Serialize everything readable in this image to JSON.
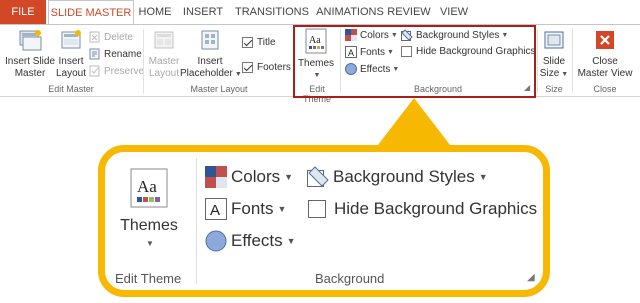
{
  "tabs": [
    "FILE",
    "SLIDE MASTER",
    "HOME",
    "INSERT",
    "TRANSITIONS",
    "ANIMATIONS",
    "REVIEW",
    "VIEW"
  ],
  "ribbon": {
    "insert_slide_master": [
      "Insert Slide",
      "Master"
    ],
    "insert_layout": [
      "Insert",
      "Layout"
    ],
    "delete": "Delete",
    "rename": "Rename",
    "preserve": "Preserve",
    "edit_master_label": "Edit Master",
    "master_layout": [
      "Master",
      "Layout"
    ],
    "insert_placeholder": [
      "Insert",
      "Placeholder"
    ],
    "title_check": "Title",
    "footers_check": "Footers",
    "master_layout_label": "Master Layout",
    "themes": "Themes",
    "edit_theme_label": "Edit Theme",
    "colors": "Colors",
    "fonts": "Fonts",
    "effects": "Effects",
    "background_styles": "Background Styles",
    "hide_background_graphics": "Hide Background Graphics",
    "background_label": "Background",
    "slide_size": [
      "Slide",
      "Size"
    ],
    "size_label": "Size",
    "close_master_view": [
      "Close",
      "Master View"
    ],
    "close_label": "Close"
  },
  "callout": {
    "themes": "Themes",
    "edit_theme_label": "Edit Theme",
    "colors": "Colors",
    "fonts": "Fonts",
    "effects": "Effects",
    "background_styles": "Background Styles",
    "hide_background_graphics": "Hide Background Graphics",
    "background_label": "Background"
  },
  "colors": {
    "file_tab": "#d24726",
    "active_tab_text": "#d24726",
    "highlight": "#a8201a",
    "callout": "#f6b800"
  }
}
